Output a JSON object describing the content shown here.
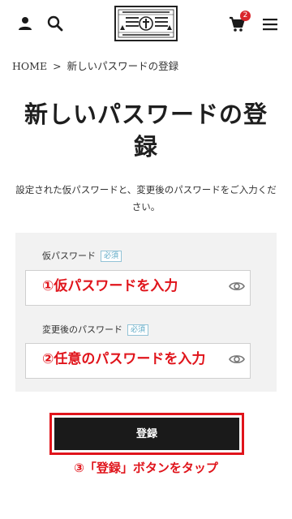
{
  "header": {
    "user_icon": "user-icon",
    "search_icon": "search-icon",
    "cart_icon": "cart-icon",
    "cart_count": "2",
    "menu_icon": "hamburger-menu-icon",
    "logo_icon": "shop-logo-emblem"
  },
  "breadcrumb": {
    "home": "HOME",
    "separator": ">",
    "current": "新しいパスワードの登録"
  },
  "page": {
    "title": "新しいパスワードの登録",
    "description": "設定された仮パスワードと、変更後のパスワードをご入力ください。"
  },
  "form": {
    "temp_password": {
      "label": "仮パスワード",
      "required": "必須",
      "hint": "①仮パスワードを入力"
    },
    "new_password": {
      "label": "変更後のパスワード",
      "required": "必須",
      "hint": "②任意のパスワードを入力"
    },
    "submit_label": "登録",
    "submit_annotation": "③「登録」ボタンをタップ"
  },
  "colors": {
    "accent_red": "#e0141b",
    "button_bg": "#1a1a1a",
    "required_badge": "#5aa7c4"
  }
}
